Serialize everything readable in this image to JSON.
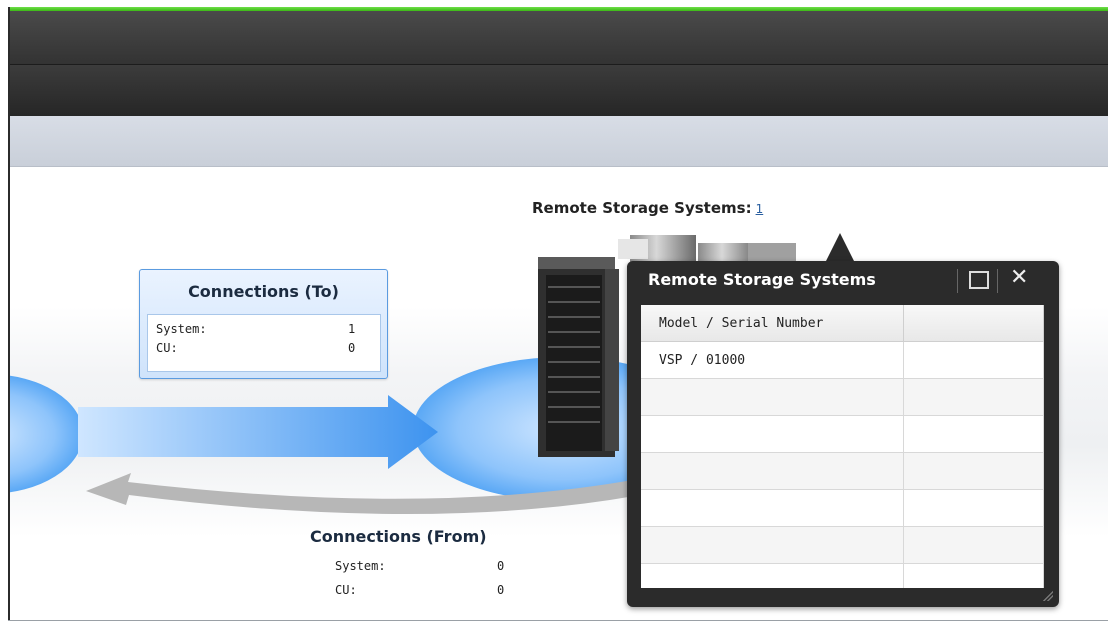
{
  "remote_storage": {
    "label": "Remote Storage Systems:",
    "count": "1"
  },
  "connections_to": {
    "title": "Connections (To)",
    "rows": [
      {
        "label": "System:",
        "value": "1"
      },
      {
        "label": "CU:",
        "value": "0"
      }
    ]
  },
  "connections_from": {
    "title": "Connections (From)",
    "rows": [
      {
        "label": "System:",
        "value": "0"
      },
      {
        "label": "CU:",
        "value": "0"
      }
    ]
  },
  "popup": {
    "title": "Remote Storage Systems",
    "columns": [
      "Model / Serial Number",
      ""
    ],
    "rows": [
      [
        "VSP / 01000",
        ""
      ],
      [
        "",
        ""
      ],
      [
        "",
        ""
      ],
      [
        "",
        ""
      ],
      [
        "",
        ""
      ],
      [
        "",
        ""
      ],
      [
        "",
        ""
      ]
    ],
    "maximize_icon": "maximize-icon",
    "close_icon": "close-icon",
    "close_glyph": "✕"
  },
  "colors": {
    "accent_green": "#4fcf2a",
    "toolbar_dark": "#333333",
    "subbar": "#d0d6df",
    "flow_blue": "#4a9cf0",
    "popup_dark": "#2b2b2b"
  }
}
